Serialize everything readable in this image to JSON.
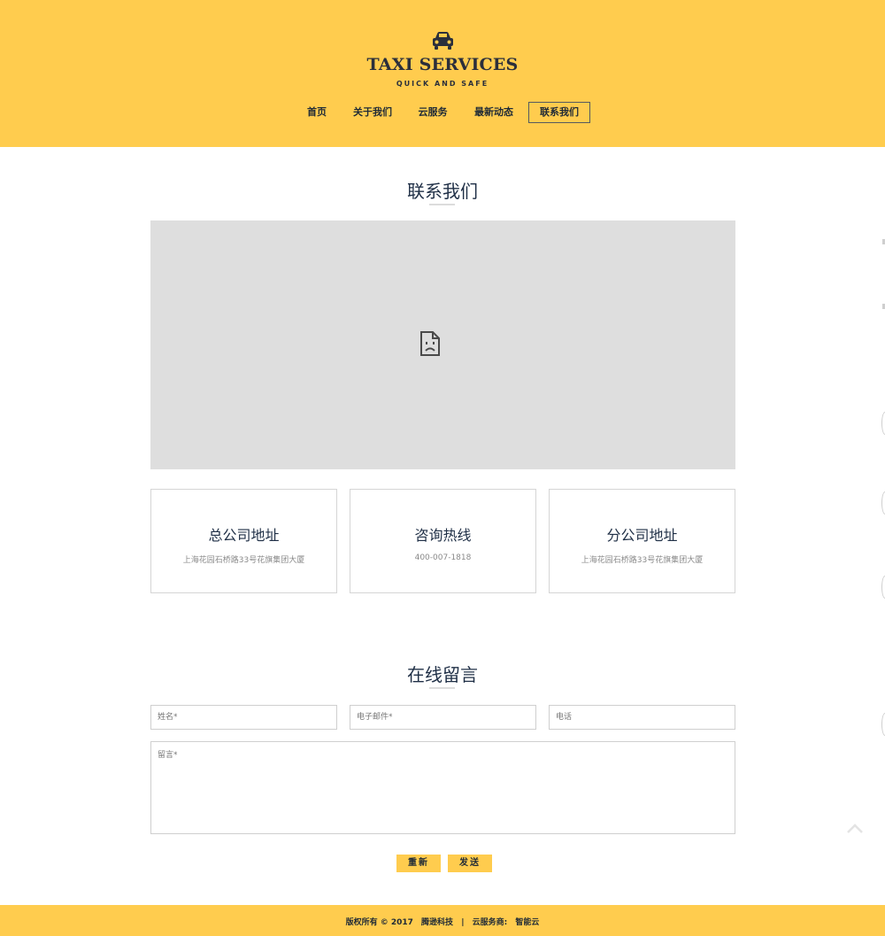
{
  "header": {
    "logo_icon": "taxi-car-icon",
    "title": "TAXI SERVICES",
    "tagline": "QUICK AND SAFE",
    "colors": {
      "background": "#ffcc4e",
      "text": "#2b2f3b"
    }
  },
  "nav": {
    "items": [
      {
        "label": "首页"
      },
      {
        "label": "关于我们"
      },
      {
        "label": "云服务"
      },
      {
        "label": "最新动态"
      },
      {
        "label": "联系我们",
        "active": true
      }
    ]
  },
  "contact": {
    "title": "联系我们",
    "map_icon": "broken-image-icon",
    "boxes": [
      {
        "title": "总公司地址",
        "text": "上海花园石桥路33号花旗集团大厦"
      },
      {
        "title": "咨询热线",
        "text": "400-007-1818"
      },
      {
        "title": "分公司地址",
        "text": "上海花园石桥路33号花旗集团大厦"
      }
    ]
  },
  "message": {
    "title": "在线留言",
    "name_placeholder": "姓名*",
    "email_placeholder": "电子邮件*",
    "phone_placeholder": "电话",
    "message_placeholder": "留言*",
    "reset_label": "重新",
    "send_label": "发送"
  },
  "footer": {
    "copyright": "版权所有 © 2017",
    "company": "腾逊科技",
    "separator": "|",
    "provider_label": "云服务商:",
    "provider": "智能云"
  },
  "scroll_top_icon": "chevron-up-icon"
}
